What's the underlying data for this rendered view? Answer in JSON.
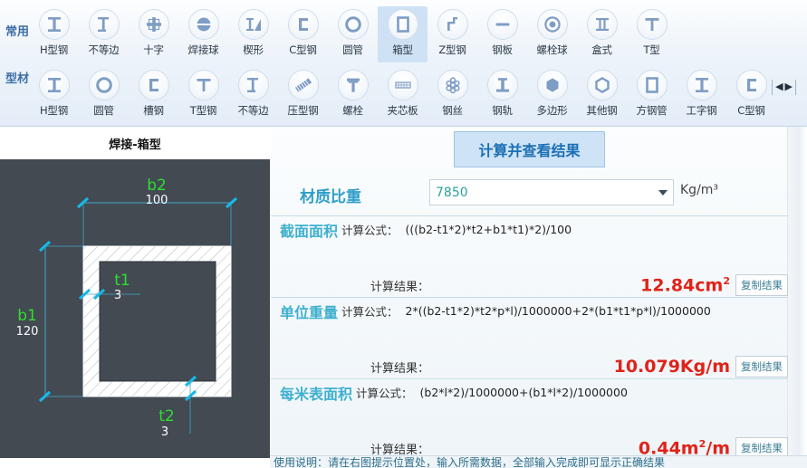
{
  "toolbar": {
    "group1_label": "常用",
    "group2_label": "型材",
    "row1": [
      {
        "label": "H型钢",
        "icon": "h-beam-icon"
      },
      {
        "label": "不等边",
        "icon": "unequal-angle-icon"
      },
      {
        "label": "十字",
        "icon": "cross-section-icon"
      },
      {
        "label": "焊接球",
        "icon": "welded-sphere-icon"
      },
      {
        "label": "楔形",
        "icon": "wedge-icon"
      },
      {
        "label": "C型钢",
        "icon": "c-channel-icon"
      },
      {
        "label": "圆管",
        "icon": "round-pipe-icon"
      },
      {
        "label": "箱型",
        "icon": "box-section-icon",
        "selected": true
      },
      {
        "label": "Z型钢",
        "icon": "z-purlin-icon"
      },
      {
        "label": "钢板",
        "icon": "steel-plate-icon"
      },
      {
        "label": "螺栓球",
        "icon": "bolt-sphere-icon"
      },
      {
        "label": "盒式",
        "icon": "box-cassette-icon"
      },
      {
        "label": "T型",
        "icon": "t-section-icon"
      }
    ],
    "row2": [
      {
        "label": "H型钢",
        "icon": "h-beam-icon"
      },
      {
        "label": "圆管",
        "icon": "round-pipe-icon"
      },
      {
        "label": "槽钢",
        "icon": "channel-steel-icon"
      },
      {
        "label": "T型钢",
        "icon": "t-steel-icon"
      },
      {
        "label": "不等边",
        "icon": "unequal-angle-icon"
      },
      {
        "label": "压型钢",
        "icon": "profiled-sheet-icon"
      },
      {
        "label": "螺栓",
        "icon": "bolt-icon"
      },
      {
        "label": "夹芯板",
        "icon": "sandwich-panel-icon"
      },
      {
        "label": "钢丝",
        "icon": "steel-wire-icon"
      },
      {
        "label": "钢轨",
        "icon": "steel-rail-icon"
      },
      {
        "label": "多边形",
        "icon": "polygon-icon"
      },
      {
        "label": "其他钢",
        "icon": "other-steel-icon"
      },
      {
        "label": "方钢管",
        "icon": "square-tube-icon"
      },
      {
        "label": "工字钢",
        "icon": "i-beam-icon"
      },
      {
        "label": "C型钢",
        "icon": "c-steel-icon"
      }
    ],
    "nav_prev": "◀",
    "nav_next": "▶"
  },
  "diagram": {
    "title": "焊接-箱型",
    "dims": [
      {
        "name": "b2",
        "value": "100"
      },
      {
        "name": "b1",
        "value": "120"
      },
      {
        "name": "t1",
        "value": "3"
      },
      {
        "name": "t2",
        "value": "3"
      }
    ],
    "bg_color": "#434a52",
    "dim_name_color": "#2ede2e",
    "dim_value_color": "#ffffff",
    "marker_color": "#17b8e8"
  },
  "panel": {
    "calculate_button": "计算并查看结果",
    "density_label": "材质比重",
    "density_value": "7850",
    "density_unit": "Kg/m³",
    "result_label": "计算结果：",
    "formula_label": "计算公式：",
    "copy_button": "复制结果",
    "sections": [
      {
        "name": "截面面积",
        "formula": "(((b2-t1*2)*t2+b1*t1)*2)/100",
        "result_number": "12.84cm",
        "result_sup": "2"
      },
      {
        "name": "单位重量",
        "formula": "2*((b2-t1*2)*t2*p*l)/1000000+2*(b1*t1*p*l)/1000000",
        "result_number": "10.079Kg/m",
        "result_sup": ""
      },
      {
        "name": "每米表面积",
        "formula": "(b2*l*2)/1000000+(b1*l*2)/1000000",
        "result_number": "0.44m",
        "result_sup": "2",
        "result_suffix": "/m"
      }
    ],
    "footer_note": "使用说明：请在右图提示位置处，输入所需数据，全部输入完成即可显示正确结果"
  }
}
